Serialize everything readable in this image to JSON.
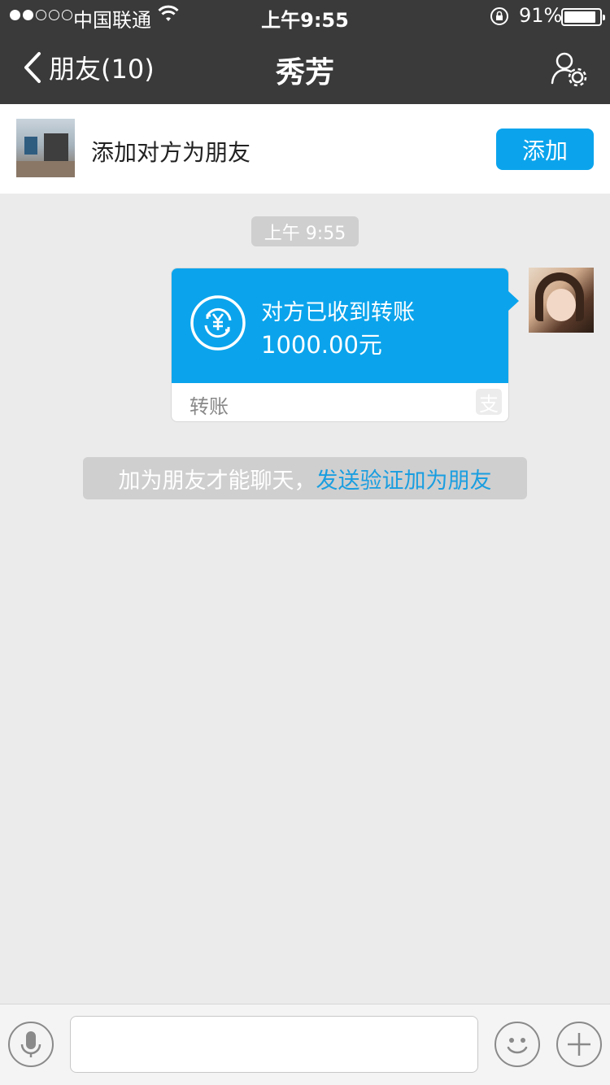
{
  "status_bar": {
    "carrier": "中国联通",
    "time": "上午9:55",
    "battery_percent": "91%",
    "battery_level": 0.91,
    "icons": [
      "signal-dots-icon",
      "wifi-icon",
      "orientation-lock-icon",
      "battery-icon"
    ]
  },
  "nav": {
    "back_label": "朋友(10)",
    "title": "秀芳",
    "icons": [
      "chevron-left-icon",
      "profile-settings-icon"
    ]
  },
  "banner": {
    "text": "添加对方为朋友",
    "button_label": "添加"
  },
  "chat": {
    "timestamp": "上午 9:55",
    "transfer": {
      "status": "对方已收到转账",
      "amount": "1000.00元",
      "footer": "转账",
      "brand_glyph": "支",
      "icon": "yuan-coin-icon"
    }
  },
  "notice": {
    "text": "加为朋友才能聊天，",
    "link": "发送验证加为朋友"
  },
  "input_bar": {
    "value": "",
    "placeholder": "",
    "icons": [
      "microphone-icon",
      "emoji-icon",
      "plus-icon"
    ]
  },
  "colors": {
    "accent": "#0ba4ec",
    "nav_bg": "#3a3a3a",
    "chat_bg": "#ebebeb",
    "link": "#1a9ee0"
  }
}
